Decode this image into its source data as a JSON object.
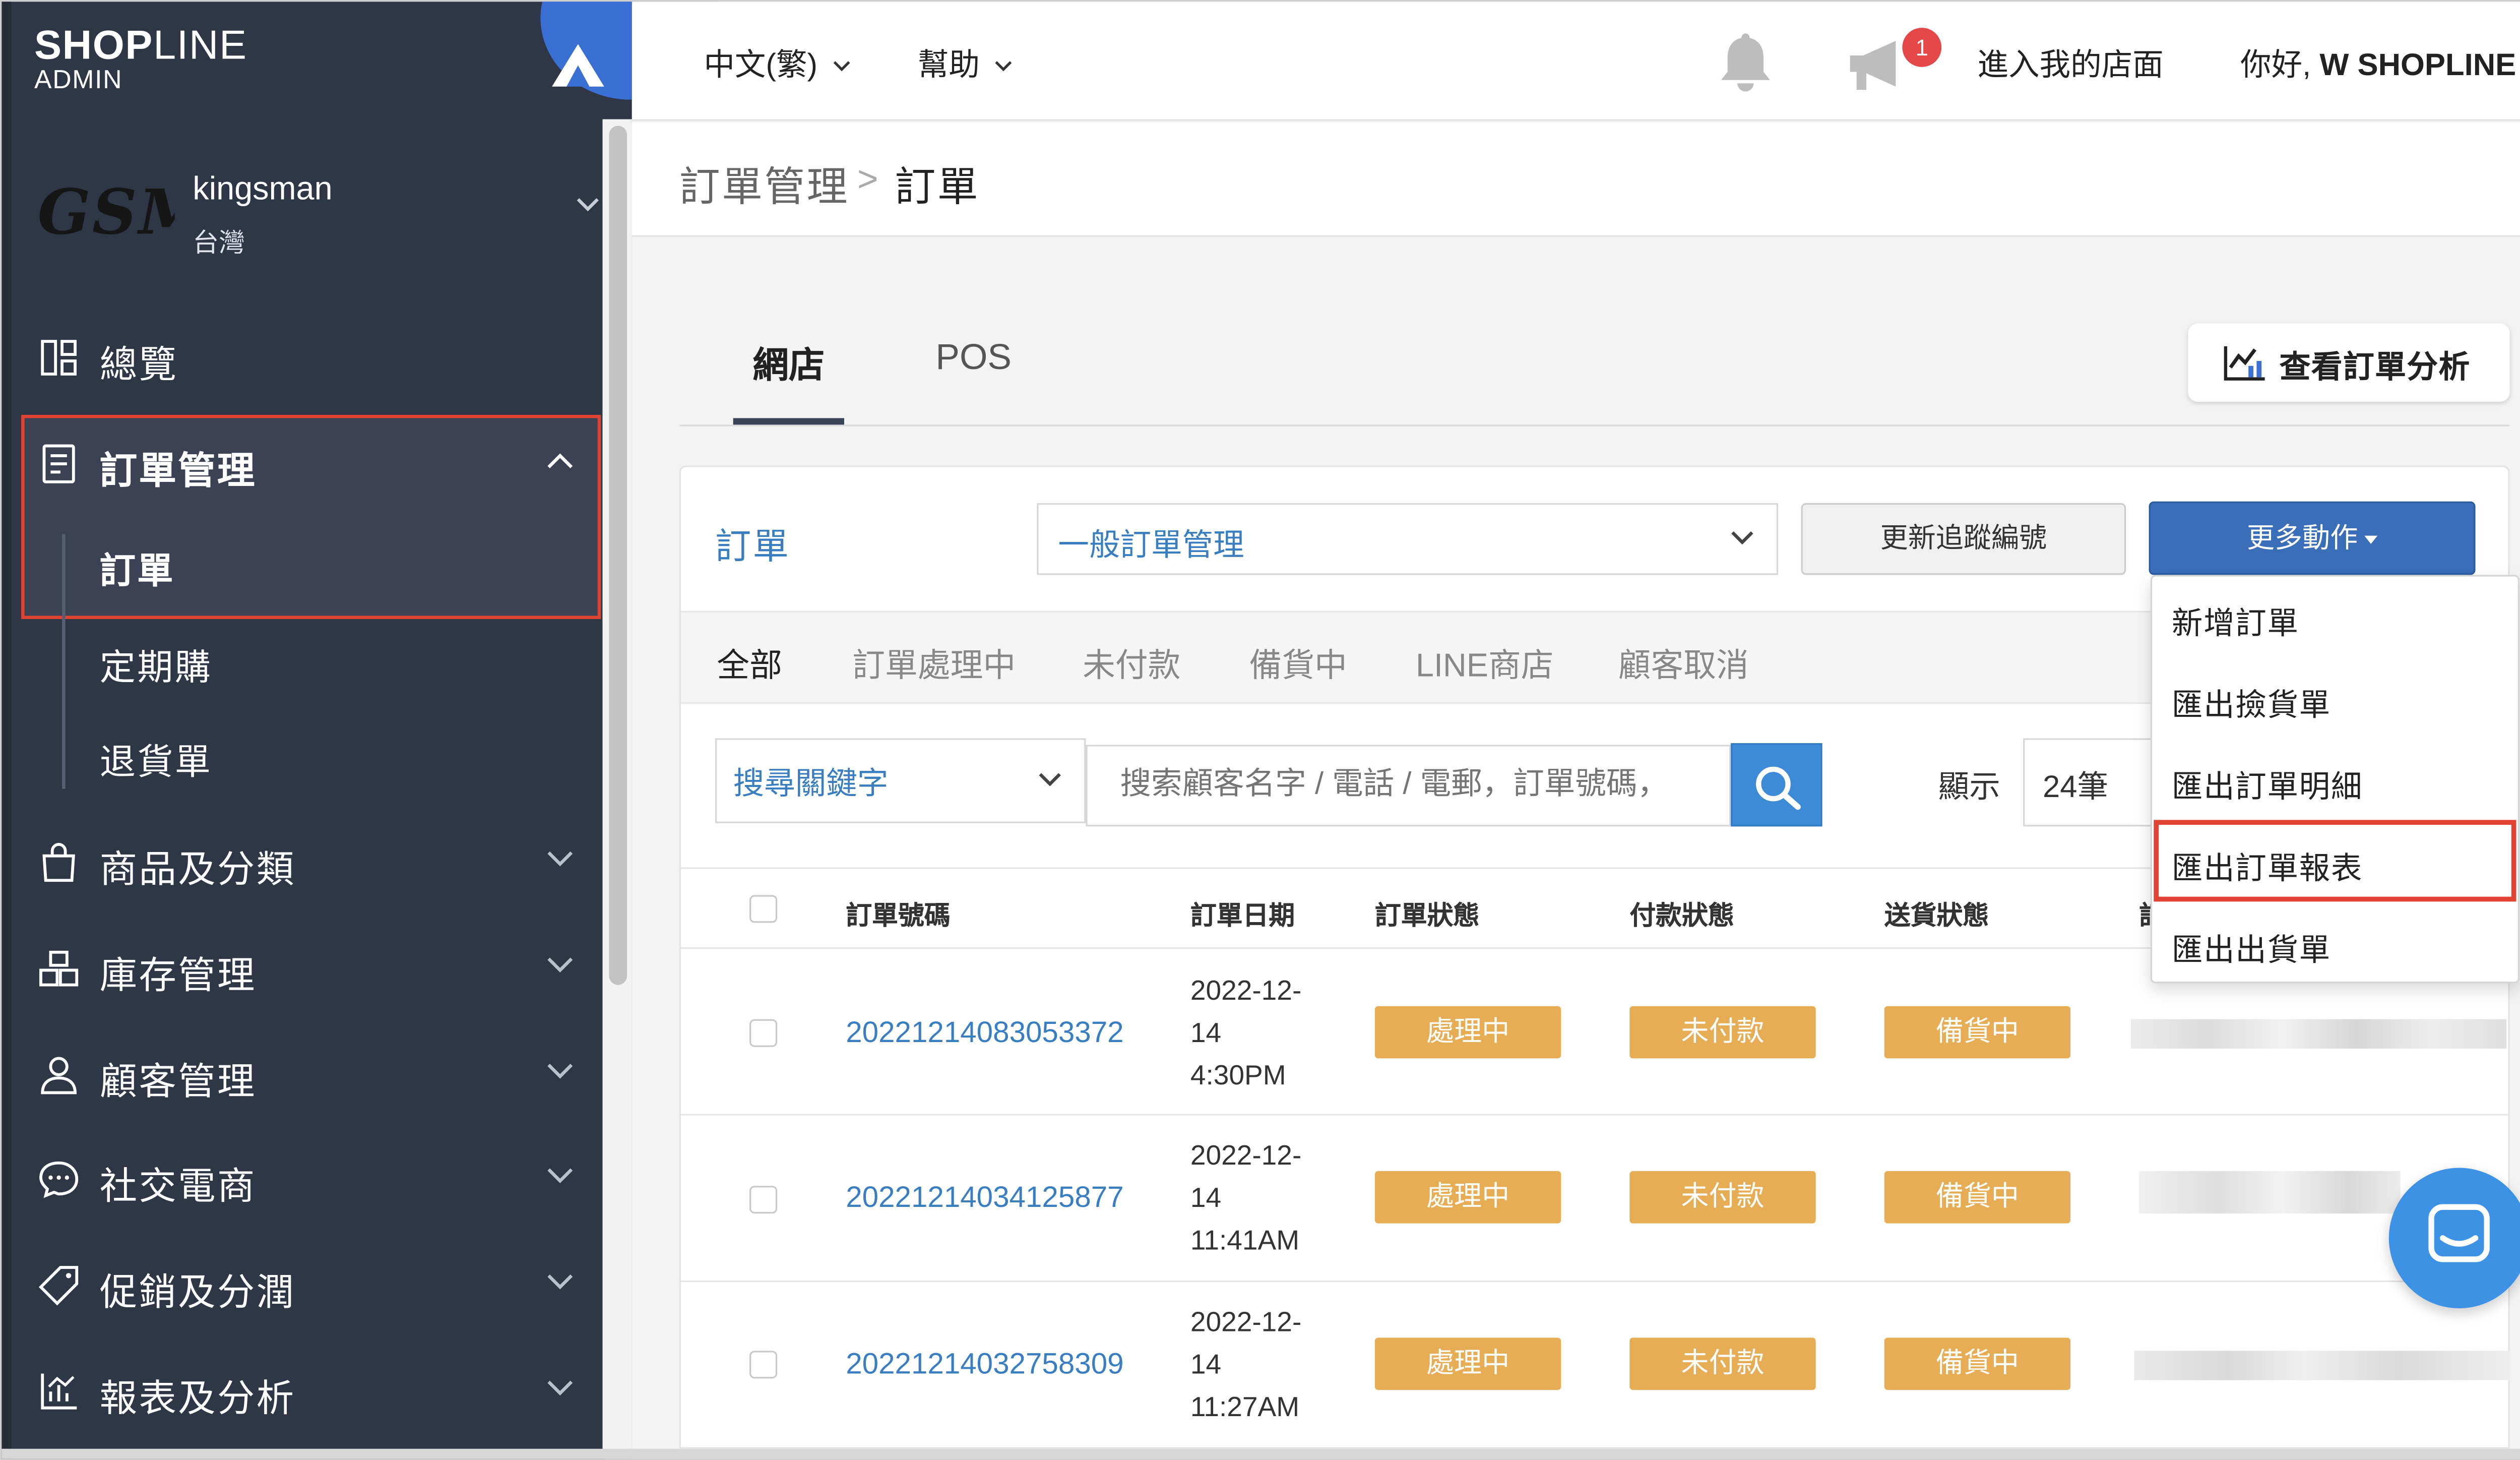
{
  "brand": {
    "logo_bold": "SHOP",
    "logo_thin": "LINE",
    "logo_sub": "ADMIN"
  },
  "store": {
    "logo_text": "GSM",
    "name": "kingsman",
    "region": "台灣"
  },
  "sidebar": {
    "items": [
      {
        "label": "總覽",
        "icon": "dashboard-icon"
      },
      {
        "label": "訂單管理",
        "icon": "document-icon",
        "expanded": true
      },
      {
        "label": "商品及分類",
        "icon": "shopping-bag-icon"
      },
      {
        "label": "庫存管理",
        "icon": "inventory-icon"
      },
      {
        "label": "顧客管理",
        "icon": "user-icon"
      },
      {
        "label": "社交電商",
        "icon": "chat-bubble-icon"
      },
      {
        "label": "促銷及分潤",
        "icon": "tag-icon"
      },
      {
        "label": "報表及分析",
        "icon": "chart-icon"
      }
    ],
    "subitems": [
      "訂單",
      "定期購",
      "退貨單"
    ]
  },
  "topbar": {
    "language": "中文(繁)",
    "help": "幫助",
    "notification_count": "1",
    "storefront": "進入我的店面",
    "greeting_prefix": "你好,",
    "greeting_user": "W SHOPLINE"
  },
  "breadcrumb": {
    "parent": "訂單管理",
    "separator": ">",
    "current": "訂單"
  },
  "channel_tabs": [
    "網店",
    "POS"
  ],
  "analytics_button": "查看訂單分析",
  "orders_card": {
    "title": "訂單",
    "type_select": "一般訂單管理",
    "update_tracking": "更新追蹤編號",
    "more_actions": "更多動作",
    "filter_tabs": [
      "全部",
      "訂單處理中",
      "未付款",
      "備貨中",
      "LINE商店",
      "顧客取消"
    ],
    "keyword_select": "搜尋關鍵字",
    "search_placeholder": "搜索顧客名字 / 電話 / 電郵，訂單號碼，",
    "show_label": "顯示",
    "page_size": "24筆",
    "columns": [
      "訂單號碼",
      "訂單日期",
      "訂單狀態",
      "付款狀態",
      "送貨狀態",
      "訂"
    ],
    "rows": [
      {
        "order_no": "20221214083053372",
        "date_l1": "2022-12-",
        "date_l2": "14",
        "date_l3": "4:30PM",
        "order_status": "處理中",
        "payment_status": "未付款",
        "delivery_status": "備貨中"
      },
      {
        "order_no": "20221214034125877",
        "date_l1": "2022-12-",
        "date_l2": "14",
        "date_l3": "11:41AM",
        "order_status": "處理中",
        "payment_status": "未付款",
        "delivery_status": "備貨中"
      },
      {
        "order_no": "20221214032758309",
        "date_l1": "2022-12-",
        "date_l2": "14",
        "date_l3": "11:27AM",
        "order_status": "處理中",
        "payment_status": "未付款",
        "delivery_status": "備貨中"
      }
    ]
  },
  "more_actions_menu": [
    "新增訂單",
    "匯出撿貨單",
    "匯出訂單明細",
    "匯出訂單報表",
    "匯出出貨單"
  ],
  "colors": {
    "sidebar_bg": "#2f3646",
    "accent_blue": "#3a6eb8",
    "link_blue": "#3a7ec2",
    "status_orange": "#e6ad55",
    "highlight_red": "#e04331",
    "badge_red": "#e54848"
  }
}
